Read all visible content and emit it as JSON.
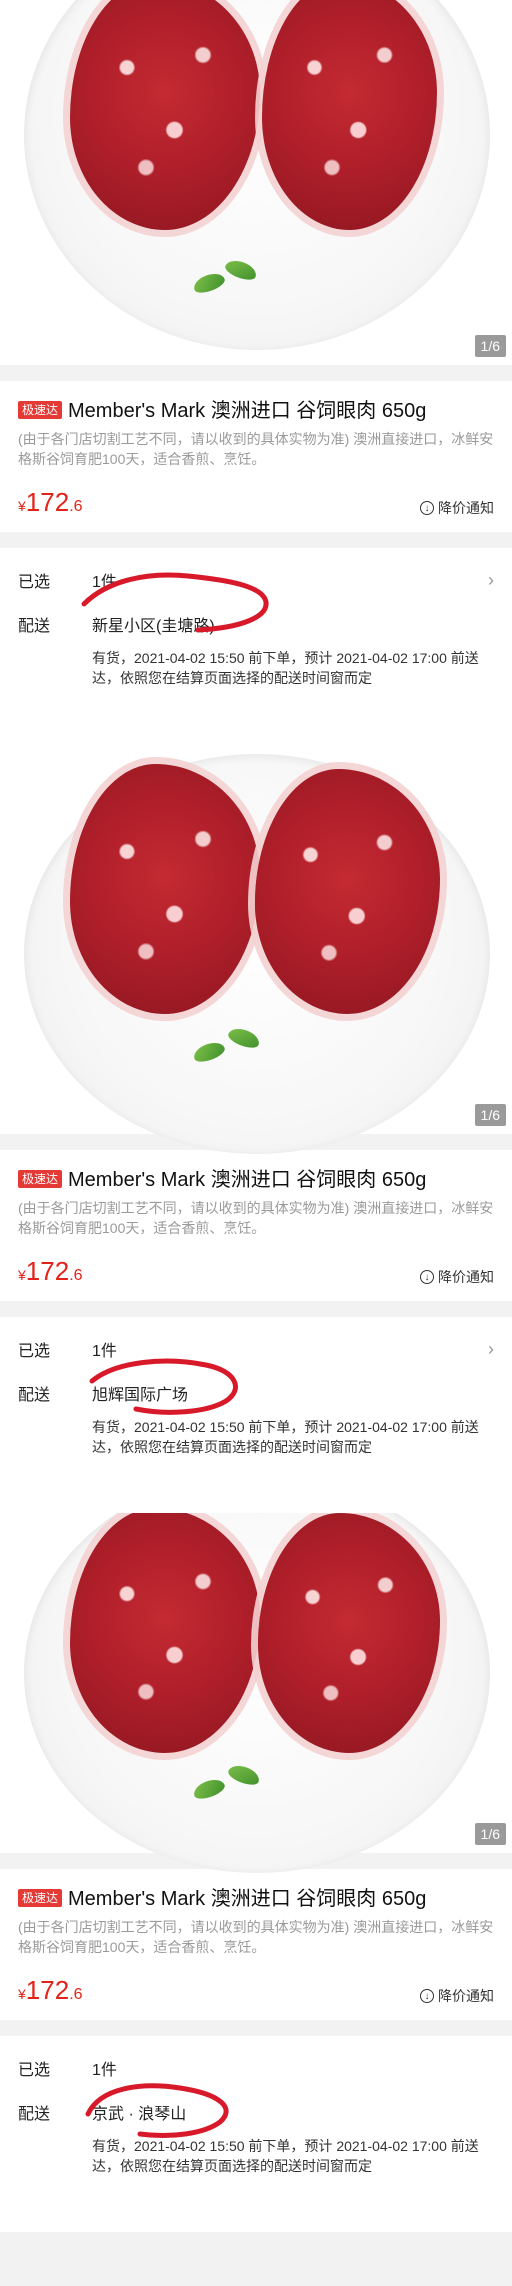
{
  "screens": [
    {
      "image": {
        "page_indicator": "1/6"
      },
      "product": {
        "badge": "极速达",
        "title": "Member's Mark 澳洲进口 谷饲眼肉 650g",
        "description": "(由于各门店切割工艺不同，请以收到的具体实物为准) 澳洲直接进口，冰鲜安格斯谷饲育肥100天，适合香煎、烹饪。",
        "price": {
          "currency": "¥",
          "integer": "172",
          "decimal": ".6"
        },
        "notify_label": "降价通知"
      },
      "selection": {
        "selected_label": "已选",
        "selected_value": "1件",
        "delivery_label": "配送",
        "address": "新星小区(圭塘路)",
        "note": "有货，2021-04-02 15:50 前下单，预计 2021-04-02 17:00 前送达，依照您在结算页面选择的配送时间窗而定"
      }
    },
    {
      "image": {
        "page_indicator": "1/6"
      },
      "product": {
        "badge": "极速达",
        "title": "Member's Mark 澳洲进口 谷饲眼肉 650g",
        "description": "(由于各门店切割工艺不同，请以收到的具体实物为准) 澳洲直接进口，冰鲜安格斯谷饲育肥100天，适合香煎、烹饪。",
        "price": {
          "currency": "¥",
          "integer": "172",
          "decimal": ".6"
        },
        "notify_label": "降价通知"
      },
      "selection": {
        "selected_label": "已选",
        "selected_value": "1件",
        "delivery_label": "配送",
        "address": "旭辉国际广场",
        "note": "有货，2021-04-02 15:50 前下单，预计 2021-04-02 17:00 前送达，依照您在结算页面选择的配送时间窗而定"
      }
    },
    {
      "image": {
        "page_indicator": "1/6"
      },
      "product": {
        "badge": "极速达",
        "title": "Member's Mark 澳洲进口 谷饲眼肉 650g",
        "description": "(由于各门店切割工艺不同，请以收到的具体实物为准) 澳洲直接进口，冰鲜安格斯谷饲育肥100天，适合香煎、烹饪。",
        "price": {
          "currency": "¥",
          "integer": "172",
          "decimal": ".6"
        },
        "notify_label": "降价通知"
      },
      "selection": {
        "selected_label": "已选",
        "selected_value": "1件",
        "delivery_label": "配送",
        "address": "京武 · 浪琴山",
        "note": "有货，2021-04-02 15:50 前下单，预计 2021-04-02 17:00 前送达，依照您在结算页面选择的配送时间窗而定"
      }
    }
  ],
  "colors": {
    "price": "#e2231a",
    "badge": "#e53935",
    "annotation": "#d8192a"
  }
}
